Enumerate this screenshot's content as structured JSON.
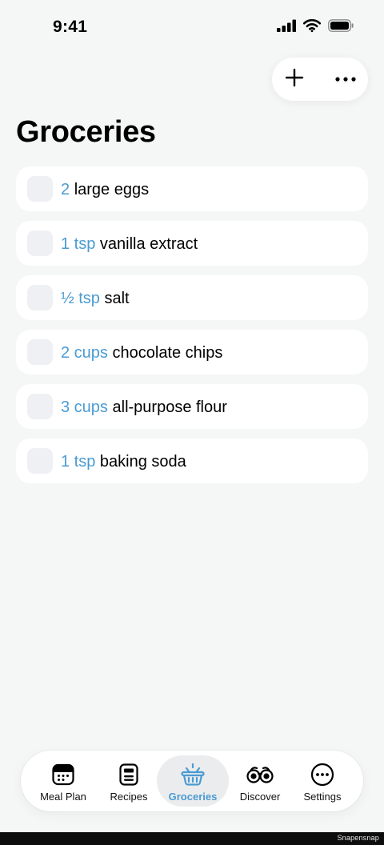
{
  "status_bar": {
    "time": "9:41",
    "icons": [
      "cellular-signal-icon",
      "wifi-icon",
      "battery-icon"
    ]
  },
  "header": {
    "title": "Groceries",
    "actions": [
      "plus-icon",
      "ellipsis-icon"
    ]
  },
  "groceries": {
    "items": [
      {
        "quantity": "2",
        "name": "large eggs",
        "checked": false
      },
      {
        "quantity": "1 tsp",
        "name": "vanilla extract",
        "checked": false
      },
      {
        "quantity": "½ tsp",
        "name": "salt",
        "checked": false
      },
      {
        "quantity": "2 cups",
        "name": "chocolate chips",
        "checked": false
      },
      {
        "quantity": "3 cups",
        "name": "all-purpose flour",
        "checked": false
      },
      {
        "quantity": "1 tsp",
        "name": "baking soda",
        "checked": false
      }
    ]
  },
  "tab_bar": {
    "tabs": [
      {
        "label": "Meal Plan",
        "icon": "calendar-icon",
        "active": false
      },
      {
        "label": "Recipes",
        "icon": "recipe-card-icon",
        "active": false
      },
      {
        "label": "Groceries",
        "icon": "basket-icon",
        "active": true
      },
      {
        "label": "Discover",
        "icon": "binoculars-icon",
        "active": false
      },
      {
        "label": "Settings",
        "icon": "ellipsis-circle-icon",
        "active": false
      }
    ]
  },
  "watermark": "Snapensnap",
  "colors": {
    "accent": "#4a9bd3",
    "background": "#f5f6f6",
    "card": "#ffffff",
    "checkbox": "#eef0f3"
  }
}
